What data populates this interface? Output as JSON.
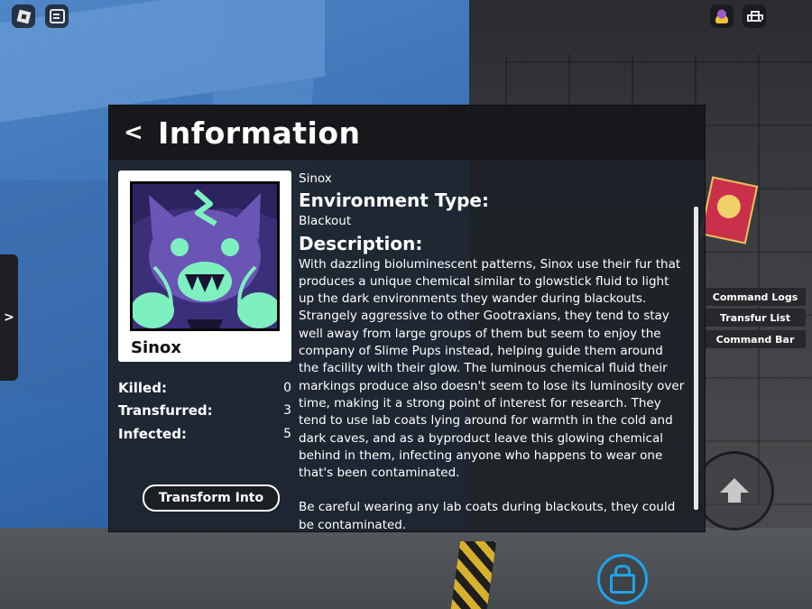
{
  "panel": {
    "back_label": "<",
    "title": "Information"
  },
  "character": {
    "name": "Sinox",
    "portrait_alt": "Sinox portrait"
  },
  "stats": [
    {
      "label": "Killed:",
      "value": "0"
    },
    {
      "label": "Transfurred:",
      "value": "3"
    },
    {
      "label": "Infected:",
      "value": "5"
    }
  ],
  "transform_button": "Transform Into",
  "details": {
    "name": "Sinox",
    "environment_heading": "Environment Type:",
    "environment_value": "Blackout",
    "description_heading": "Description:",
    "description_p1": "With dazzling bioluminescent patterns, Sinox use their fur that produces a unique chemical similar to glowstick fluid to light up the dark environments they wander during blackouts.",
    "description_p2": "Strangely aggressive to other Gootraxians, they tend to stay well away from large groups of them but seem to enjoy the company of Slime Pups instead, helping guide them around the facility with their glow. The luminous chemical fluid their markings produce also doesn't seem to lose its luminosity over time, making it a strong point of interest for research. They tend to use lab coats lying around for warmth in the cold and dark caves, and as a byproduct leave this glowing chemical behind in them, infecting anyone who happens to wear one that's been contaminated.",
    "description_p3": "Be careful wearing any lab coats during blackouts, they could be contaminated."
  },
  "side_tab_label": ">",
  "commands": {
    "logs": "Command Logs",
    "transfur_list": "Transfur List",
    "command_bar": "Command Bar"
  },
  "icons": {
    "roblox_menu": "roblox-logo-icon",
    "chat": "chat-icon",
    "avatar": "avatar-icon",
    "leaderboard": "leaderboard-icon",
    "jump": "jump-arrow-icon",
    "shift_lock": "lock-icon"
  },
  "colors": {
    "panel_bg": "#1c2026",
    "header_bg": "#16181b",
    "accent_lock": "#1fa3ea",
    "portrait_bg": "#5e4aa6",
    "portrait_glow": "#7ef0c0"
  }
}
